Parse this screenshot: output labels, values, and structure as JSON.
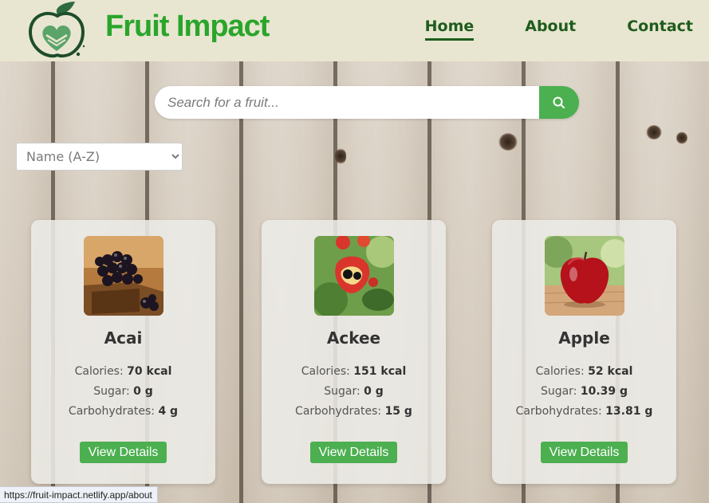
{
  "brand": {
    "name": "Fruit Impact"
  },
  "nav": {
    "home": "Home",
    "about": "About",
    "contact": "Contact",
    "active": "Home"
  },
  "search": {
    "placeholder": "Search for a fruit..."
  },
  "sort": {
    "selected": "Name (A-Z)"
  },
  "labels": {
    "calories": "Calories:",
    "sugar": "Sugar:",
    "carbs": "Carbohydrates:",
    "button": "View Details"
  },
  "fruits": [
    {
      "name": "Acai",
      "calories": "70 kcal",
      "sugar": "0 g",
      "carbs": "4 g"
    },
    {
      "name": "Ackee",
      "calories": "151 kcal",
      "sugar": "0 g",
      "carbs": "15 g"
    },
    {
      "name": "Apple",
      "calories": "52 kcal",
      "sugar": "10.39 g",
      "carbs": "13.81 g"
    }
  ],
  "status_bar": {
    "url": "https://fruit-impact.netlify.app/about"
  },
  "colors": {
    "header_bg": "#e8e6d0",
    "brand_green": "#2aa52c",
    "nav_green": "#1f5c1d",
    "button_green": "#4caf50"
  }
}
